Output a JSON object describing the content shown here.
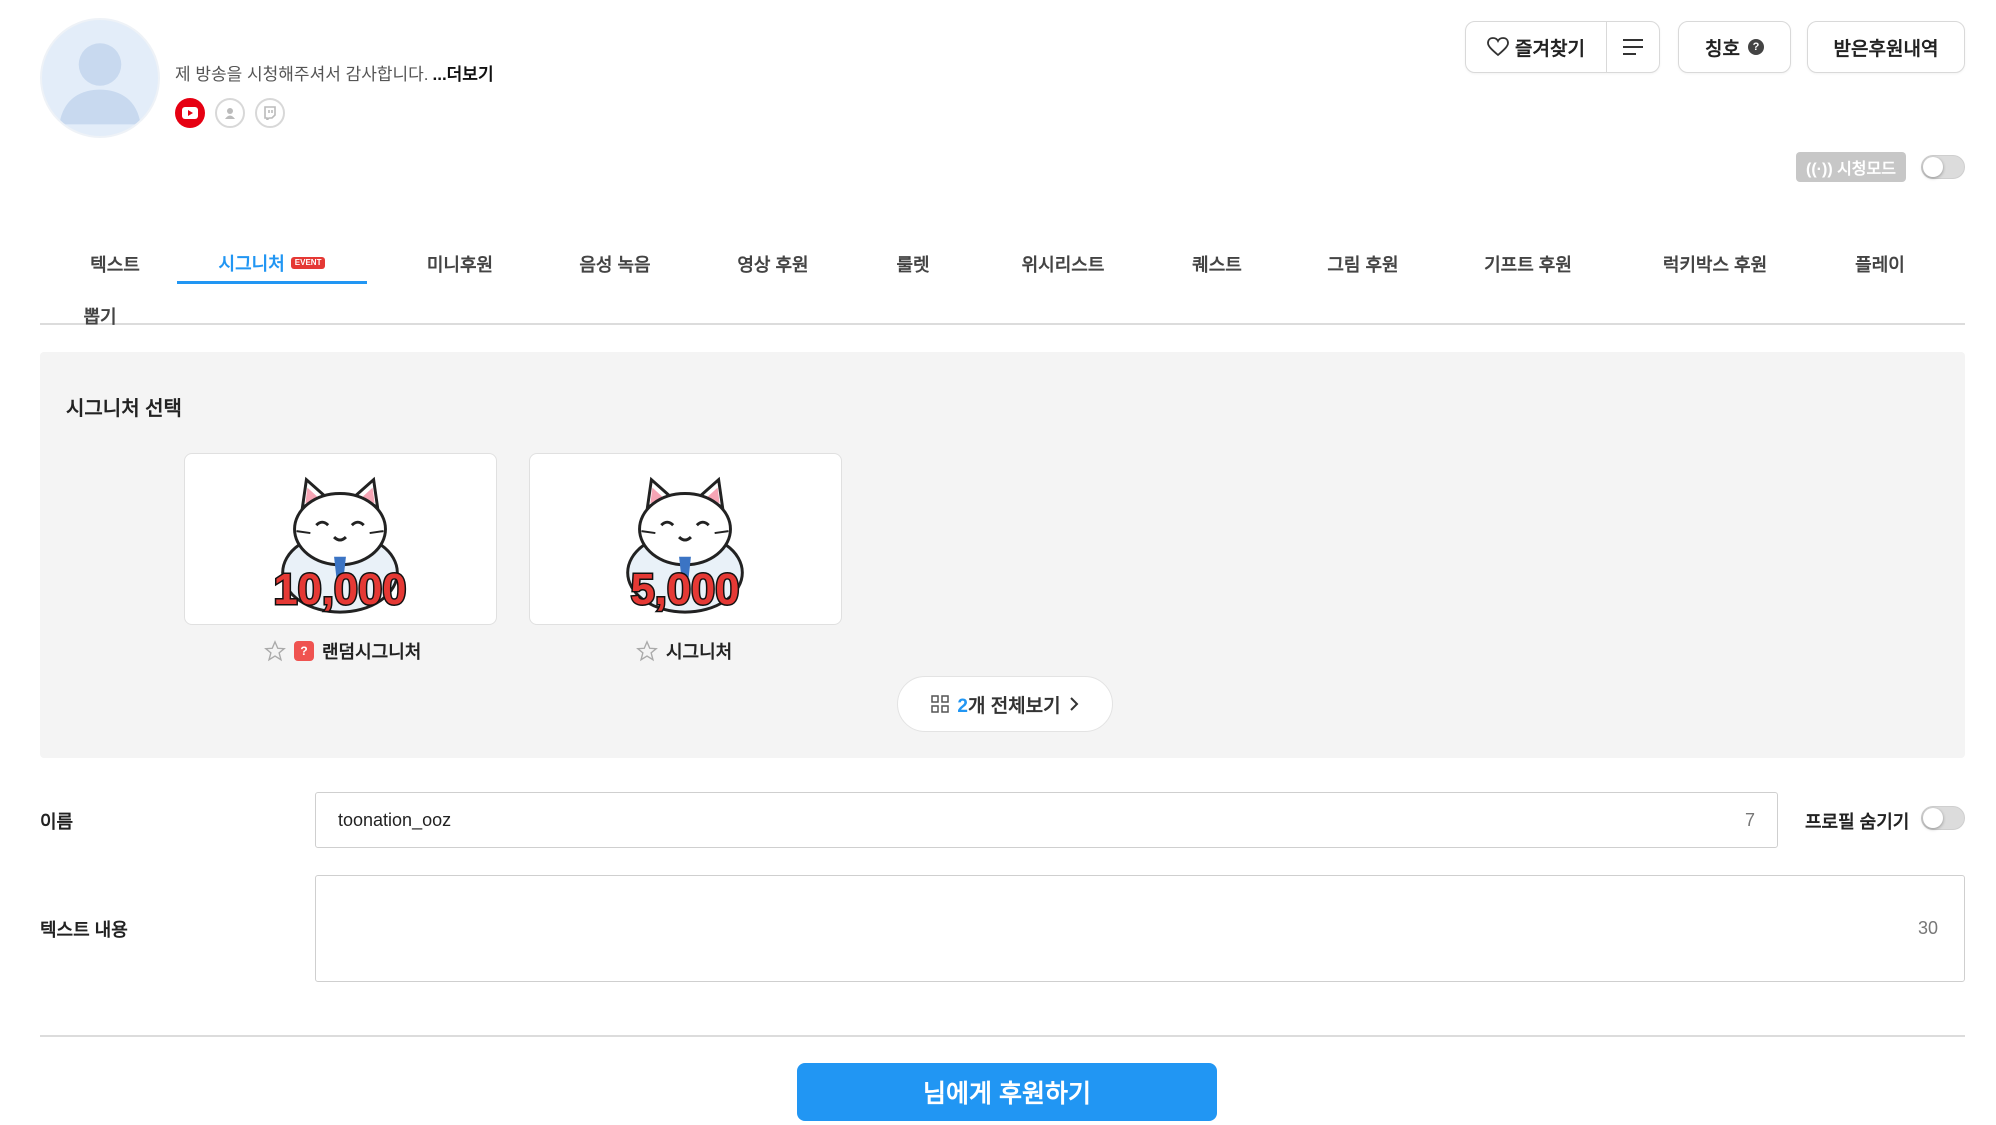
{
  "profile": {
    "greeting": "제 방송을 시청해주셔서 감사합니다.",
    "more_label": "...더보기",
    "socials": [
      "youtube-icon",
      "afreeca-icon",
      "twitch-icon"
    ]
  },
  "header": {
    "favorite_label": "즐겨찾기",
    "title_label": "칭호",
    "title_help": "?",
    "history_label": "받은후원내역",
    "viewmode_label": "((·)) 시청모드",
    "viewmode_on": false
  },
  "tabs": [
    {
      "label": "텍스트",
      "active": false
    },
    {
      "label": "시그니처",
      "active": true,
      "badge": "EVENT"
    },
    {
      "label": "미니후원",
      "active": false
    },
    {
      "label": "음성 녹음",
      "active": false
    },
    {
      "label": "영상 후원",
      "active": false
    },
    {
      "label": "룰렛",
      "active": false
    },
    {
      "label": "위시리스트",
      "active": false
    },
    {
      "label": "퀘스트",
      "active": false
    },
    {
      "label": "그림 후원",
      "active": false
    },
    {
      "label": "기프트 후원",
      "active": false
    },
    {
      "label": "럭키박스 후원",
      "active": false
    },
    {
      "label": "플레이",
      "active": false
    },
    {
      "label": "뽑기",
      "active": false
    }
  ],
  "signature": {
    "title": "시그니처 선택",
    "cards": [
      {
        "amount": "10,000",
        "label": "랜덤시그니처",
        "random_badge": "?"
      },
      {
        "amount": "5,000",
        "label": "시그니처"
      }
    ],
    "view_all_count": "2",
    "view_all_label": "개 전체보기"
  },
  "form": {
    "name_label": "이름",
    "name_value": "toonation_ooz",
    "name_counter": "7",
    "hide_profile_label": "프로필 숨기기",
    "hide_profile_on": false,
    "text_label": "텍스트 내용",
    "text_value": "",
    "text_counter": "30"
  },
  "submit": {
    "label": "님에게 후원하기"
  },
  "colors": {
    "accent": "#2196f3",
    "youtube": "#e60012",
    "event_badge": "#e53935",
    "panel_bg": "#f4f4f4"
  }
}
